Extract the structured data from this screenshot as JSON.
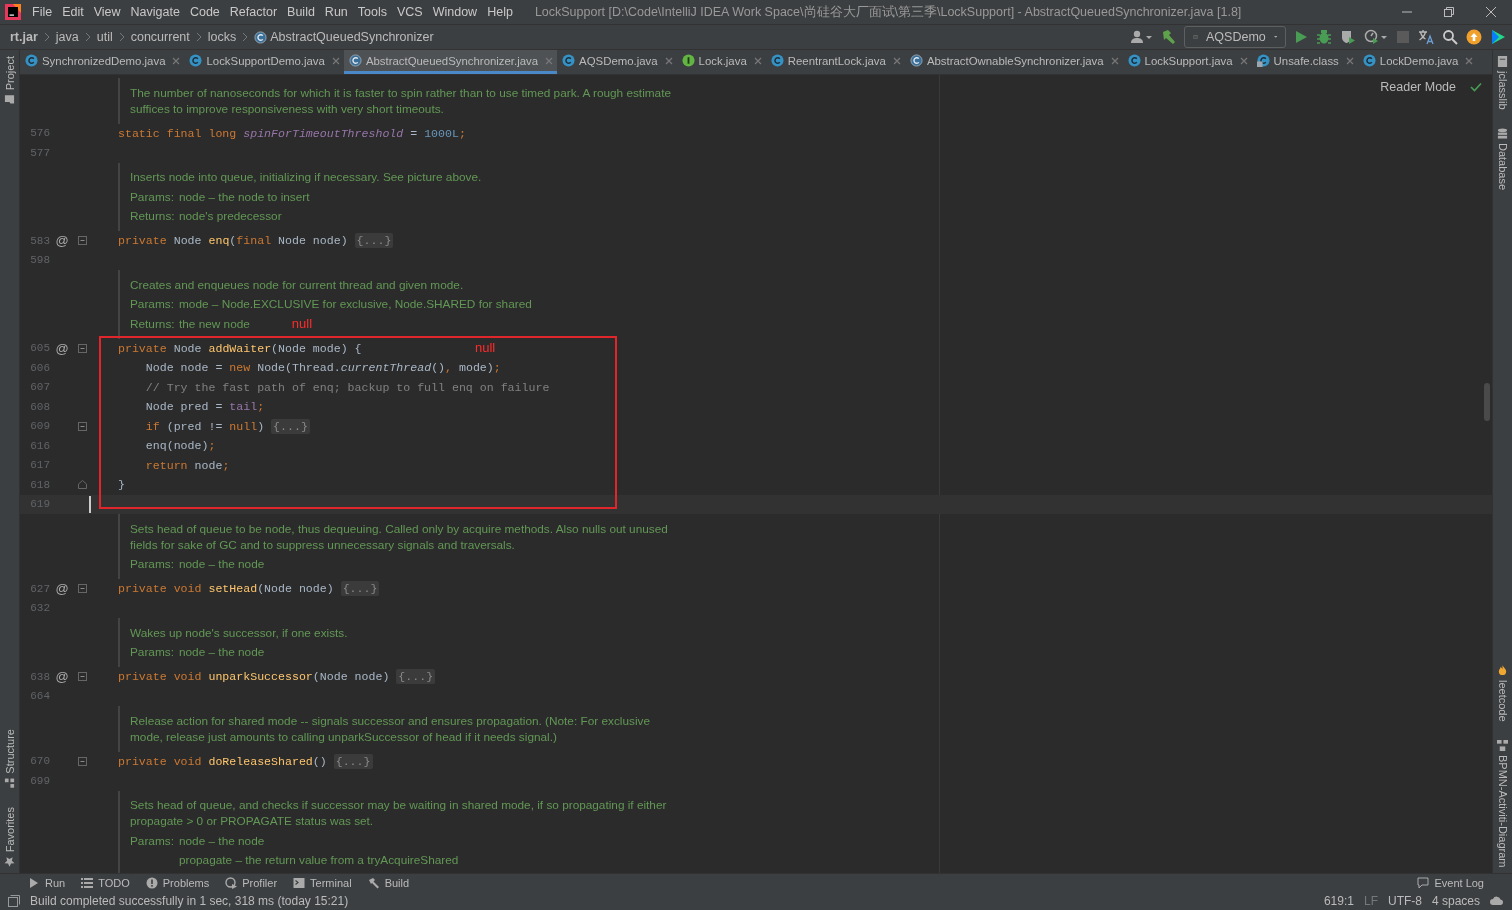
{
  "menu": [
    "File",
    "Edit",
    "View",
    "Navigate",
    "Code",
    "Refactor",
    "Build",
    "Run",
    "Tools",
    "VCS",
    "Window",
    "Help"
  ],
  "window": {
    "title": "LockSupport [D:\\Code\\IntelliJ IDEA Work Space\\尚硅谷大厂面试\\第三季\\LockSupport] - AbstractQueuedSynchronizer.java [1.8]"
  },
  "breadcrumbs": [
    {
      "text": "rt.jar",
      "kind": "root"
    },
    {
      "text": "java",
      "kind": "package"
    },
    {
      "text": "util",
      "kind": "package"
    },
    {
      "text": "concurrent",
      "kind": "package"
    },
    {
      "text": "locks",
      "kind": "package"
    },
    {
      "text": "AbstractQueuedSynchronizer",
      "kind": "class"
    }
  ],
  "toolbar": {
    "run_config": "AQSDemo"
  },
  "left_strip": {
    "top": [
      {
        "label": "Project",
        "kind": "project"
      }
    ],
    "bottom": [
      {
        "label": "Structure",
        "kind": "structure"
      },
      {
        "label": "Favorites",
        "kind": "favorites"
      }
    ]
  },
  "right_strip": {
    "top": [
      {
        "label": "jclasslib",
        "kind": "jclasslib"
      },
      {
        "label": "Database",
        "kind": "database"
      }
    ],
    "bottom": [
      {
        "label": "leetcode",
        "kind": "leetcode"
      },
      {
        "label": "BPMN-Activiti-Diagram",
        "kind": "diagram"
      }
    ]
  },
  "tabs": [
    {
      "label": "SynchronizedDemo.java",
      "kind": "class",
      "selected": false
    },
    {
      "label": "LockSupportDemo.java",
      "kind": "class",
      "selected": false
    },
    {
      "label": "AbstractQueuedSynchronizer.java",
      "kind": "abstract",
      "selected": true
    },
    {
      "label": "AQSDemo.java",
      "kind": "class",
      "selected": false
    },
    {
      "label": "Lock.java",
      "kind": "interface",
      "selected": false
    },
    {
      "label": "ReentrantLock.java",
      "kind": "class",
      "selected": false
    },
    {
      "label": "AbstractOwnableSynchronizer.java",
      "kind": "abstract",
      "selected": false
    },
    {
      "label": "LockSupport.java",
      "kind": "class",
      "selected": false
    },
    {
      "label": "Unsafe.class",
      "kind": "compiled",
      "selected": false
    },
    {
      "label": "LockDemo.java",
      "kind": "class",
      "selected": false
    }
  ],
  "editor": {
    "reader_mode": "Reader Mode",
    "blocks": [
      {
        "kind": "doc",
        "items": [
          {
            "kind": "text",
            "text": "The number of nanoseconds for which it is faster to spin rather than to use timed park. A rough estimate suffices to improve responsiveness with very short timeouts."
          }
        ]
      },
      {
        "kind": "code",
        "lines": [
          {
            "number": "576",
            "kind": "plain",
            "current": false,
            "tokens": [
              {
                "kind": "kw",
                "text": "static final long "
              },
              {
                "kind": "fieldi",
                "text": "spinForTimeoutThreshold"
              },
              {
                "kind": "plain",
                "text": " = "
              },
              {
                "kind": "num",
                "text": "1000L"
              },
              {
                "kind": "kw",
                "text": ";"
              }
            ]
          },
          {
            "number": "577",
            "kind": "plain",
            "current": false
          }
        ]
      },
      {
        "kind": "doc",
        "items": [
          {
            "kind": "text",
            "text": "Inserts node into queue, initializing if necessary. See picture above."
          },
          {
            "kind": "tag",
            "label": "Params:",
            "value": "node – the node to insert"
          },
          {
            "kind": "tag",
            "label": "Returns:",
            "value": "node's predecessor"
          }
        ]
      },
      {
        "kind": "code",
        "lines": [
          {
            "number": "583",
            "marker": "@",
            "kind": "foldable",
            "current": false,
            "tokens": [
              {
                "kind": "kw",
                "text": "private "
              },
              {
                "kind": "plain",
                "text": "Node "
              },
              {
                "kind": "fn",
                "text": "enq"
              },
              {
                "kind": "plain",
                "text": "("
              },
              {
                "kind": "kw",
                "text": "final "
              },
              {
                "kind": "plain",
                "text": "Node node) "
              },
              {
                "kind": "fold",
                "text": "{...}"
              }
            ]
          },
          {
            "number": "598",
            "kind": "plain",
            "current": false
          }
        ]
      },
      {
        "kind": "doc",
        "items": [
          {
            "kind": "text",
            "text": "Creates and enqueues node for current thread and given mode."
          },
          {
            "kind": "tag",
            "label": "Params:",
            "value": "mode – Node.EXCLUSIVE for exclusive, Node.SHARED for shared"
          },
          {
            "kind": "tag",
            "label": "Returns:",
            "value": "the new node",
            "note": "null"
          }
        ]
      },
      {
        "kind": "boxed",
        "note": "null",
        "lines": [
          {
            "number": "605",
            "marker": "@",
            "kind": "foldable",
            "current": false,
            "tokens": [
              {
                "kind": "kw",
                "text": "private "
              },
              {
                "kind": "plain",
                "text": "Node "
              },
              {
                "kind": "fn",
                "text": "addWaiter"
              },
              {
                "kind": "plain",
                "text": "(Node mode) {"
              }
            ]
          },
          {
            "number": "606",
            "kind": "plain",
            "current": false,
            "tokens": [
              {
                "kind": "plain",
                "text": "    Node node = "
              },
              {
                "kind": "kw",
                "text": "new "
              },
              {
                "kind": "plain",
                "text": "Node(Thread."
              },
              {
                "kind": "calli",
                "text": "currentThread"
              },
              {
                "kind": "plain",
                "text": "()"
              },
              {
                "kind": "kw",
                "text": ", "
              },
              {
                "kind": "plain",
                "text": "mode)"
              },
              {
                "kind": "kw",
                "text": ";"
              }
            ]
          },
          {
            "number": "607",
            "kind": "plain",
            "current": false,
            "tokens": [
              {
                "kind": "comment",
                "text": "    // Try the fast path of enq; backup to full enq on failure"
              }
            ]
          },
          {
            "number": "608",
            "kind": "plain",
            "current": false,
            "tokens": [
              {
                "kind": "plain",
                "text": "    Node pred = "
              },
              {
                "kind": "field",
                "text": "tail"
              },
              {
                "kind": "kw",
                "text": ";"
              }
            ]
          },
          {
            "number": "609",
            "kind": "foldable",
            "current": false,
            "tokens": [
              {
                "kind": "kw",
                "text": "    if "
              },
              {
                "kind": "plain",
                "text": "(pred != "
              },
              {
                "kind": "kw",
                "text": "null"
              },
              {
                "kind": "plain",
                "text": ") "
              },
              {
                "kind": "fold",
                "text": "{...}"
              }
            ]
          },
          {
            "number": "616",
            "kind": "plain",
            "current": false,
            "tokens": [
              {
                "kind": "plain",
                "text": "    enq(node)"
              },
              {
                "kind": "kw",
                "text": ";"
              }
            ]
          },
          {
            "number": "617",
            "kind": "plain",
            "current": false,
            "tokens": [
              {
                "kind": "kw",
                "text": "    return "
              },
              {
                "kind": "plain",
                "text": "node"
              },
              {
                "kind": "kw",
                "text": ";"
              }
            ]
          },
          {
            "number": "618",
            "kind": "fold-end",
            "current": false,
            "tokens": [
              {
                "kind": "plain",
                "text": "}"
              }
            ]
          },
          {
            "number": "619",
            "kind": "plain",
            "current": true
          }
        ]
      },
      {
        "kind": "doc",
        "items": [
          {
            "kind": "text",
            "text": "Sets head of queue to be node, thus dequeuing. Called only by acquire methods. Also nulls out unused fields for sake of GC and to suppress unnecessary signals and traversals."
          },
          {
            "kind": "tag",
            "label": "Params:",
            "value": "node – the node"
          }
        ]
      },
      {
        "kind": "code",
        "lines": [
          {
            "number": "627",
            "marker": "@",
            "kind": "foldable",
            "current": false,
            "tokens": [
              {
                "kind": "kw",
                "text": "private void "
              },
              {
                "kind": "fn",
                "text": "setHead"
              },
              {
                "kind": "plain",
                "text": "(Node node) "
              },
              {
                "kind": "fold",
                "text": "{...}"
              }
            ]
          },
          {
            "number": "632",
            "kind": "plain",
            "current": false
          }
        ]
      },
      {
        "kind": "doc",
        "items": [
          {
            "kind": "text",
            "text": "Wakes up node's successor, if one exists."
          },
          {
            "kind": "tag",
            "label": "Params:",
            "value": "node – the node"
          }
        ]
      },
      {
        "kind": "code",
        "lines": [
          {
            "number": "638",
            "marker": "@",
            "kind": "foldable",
            "current": false,
            "tokens": [
              {
                "kind": "kw",
                "text": "private void "
              },
              {
                "kind": "fn",
                "text": "unparkSuccessor"
              },
              {
                "kind": "plain",
                "text": "(Node node) "
              },
              {
                "kind": "fold",
                "text": "{...}"
              }
            ]
          },
          {
            "number": "664",
            "kind": "plain",
            "current": false
          }
        ]
      },
      {
        "kind": "doc",
        "items": [
          {
            "kind": "text",
            "text": "Release action for shared mode -- signals successor and ensures propagation. (Note: For exclusive mode, release just amounts to calling unparkSuccessor of head if it needs signal.)"
          }
        ]
      },
      {
        "kind": "code",
        "lines": [
          {
            "number": "670",
            "kind": "foldable",
            "current": false,
            "tokens": [
              {
                "kind": "kw",
                "text": "private void "
              },
              {
                "kind": "fn",
                "text": "doReleaseShared"
              },
              {
                "kind": "plain",
                "text": "() "
              },
              {
                "kind": "fold",
                "text": "{...}"
              }
            ]
          },
          {
            "number": "699",
            "kind": "plain",
            "current": false
          }
        ]
      },
      {
        "kind": "doc",
        "items": [
          {
            "kind": "text",
            "text": "Sets head of queue, and checks if successor may be waiting in shared mode, if so propagating if either propagate > 0 or PROPAGATE status was set."
          },
          {
            "kind": "tag",
            "label": "Params:",
            "value": "node – the node"
          },
          {
            "kind": "cont",
            "value": "propagate – the return value from a tryAcquireShared"
          }
        ]
      }
    ]
  },
  "bottom_tools": [
    {
      "label": "Run",
      "kind": "run"
    },
    {
      "label": "TODO",
      "kind": "todo"
    },
    {
      "label": "Problems",
      "kind": "problems"
    },
    {
      "label": "Profiler",
      "kind": "profiler"
    },
    {
      "label": "Terminal",
      "kind": "terminal"
    },
    {
      "label": "Build",
      "kind": "build"
    }
  ],
  "event_log": "Event Log",
  "status": {
    "message": "Build completed successfully in 1 sec, 318 ms (today 15:21)",
    "position": "619:1",
    "line_separator": "LF",
    "encoding": "UTF-8",
    "indent": "4 spaces"
  }
}
